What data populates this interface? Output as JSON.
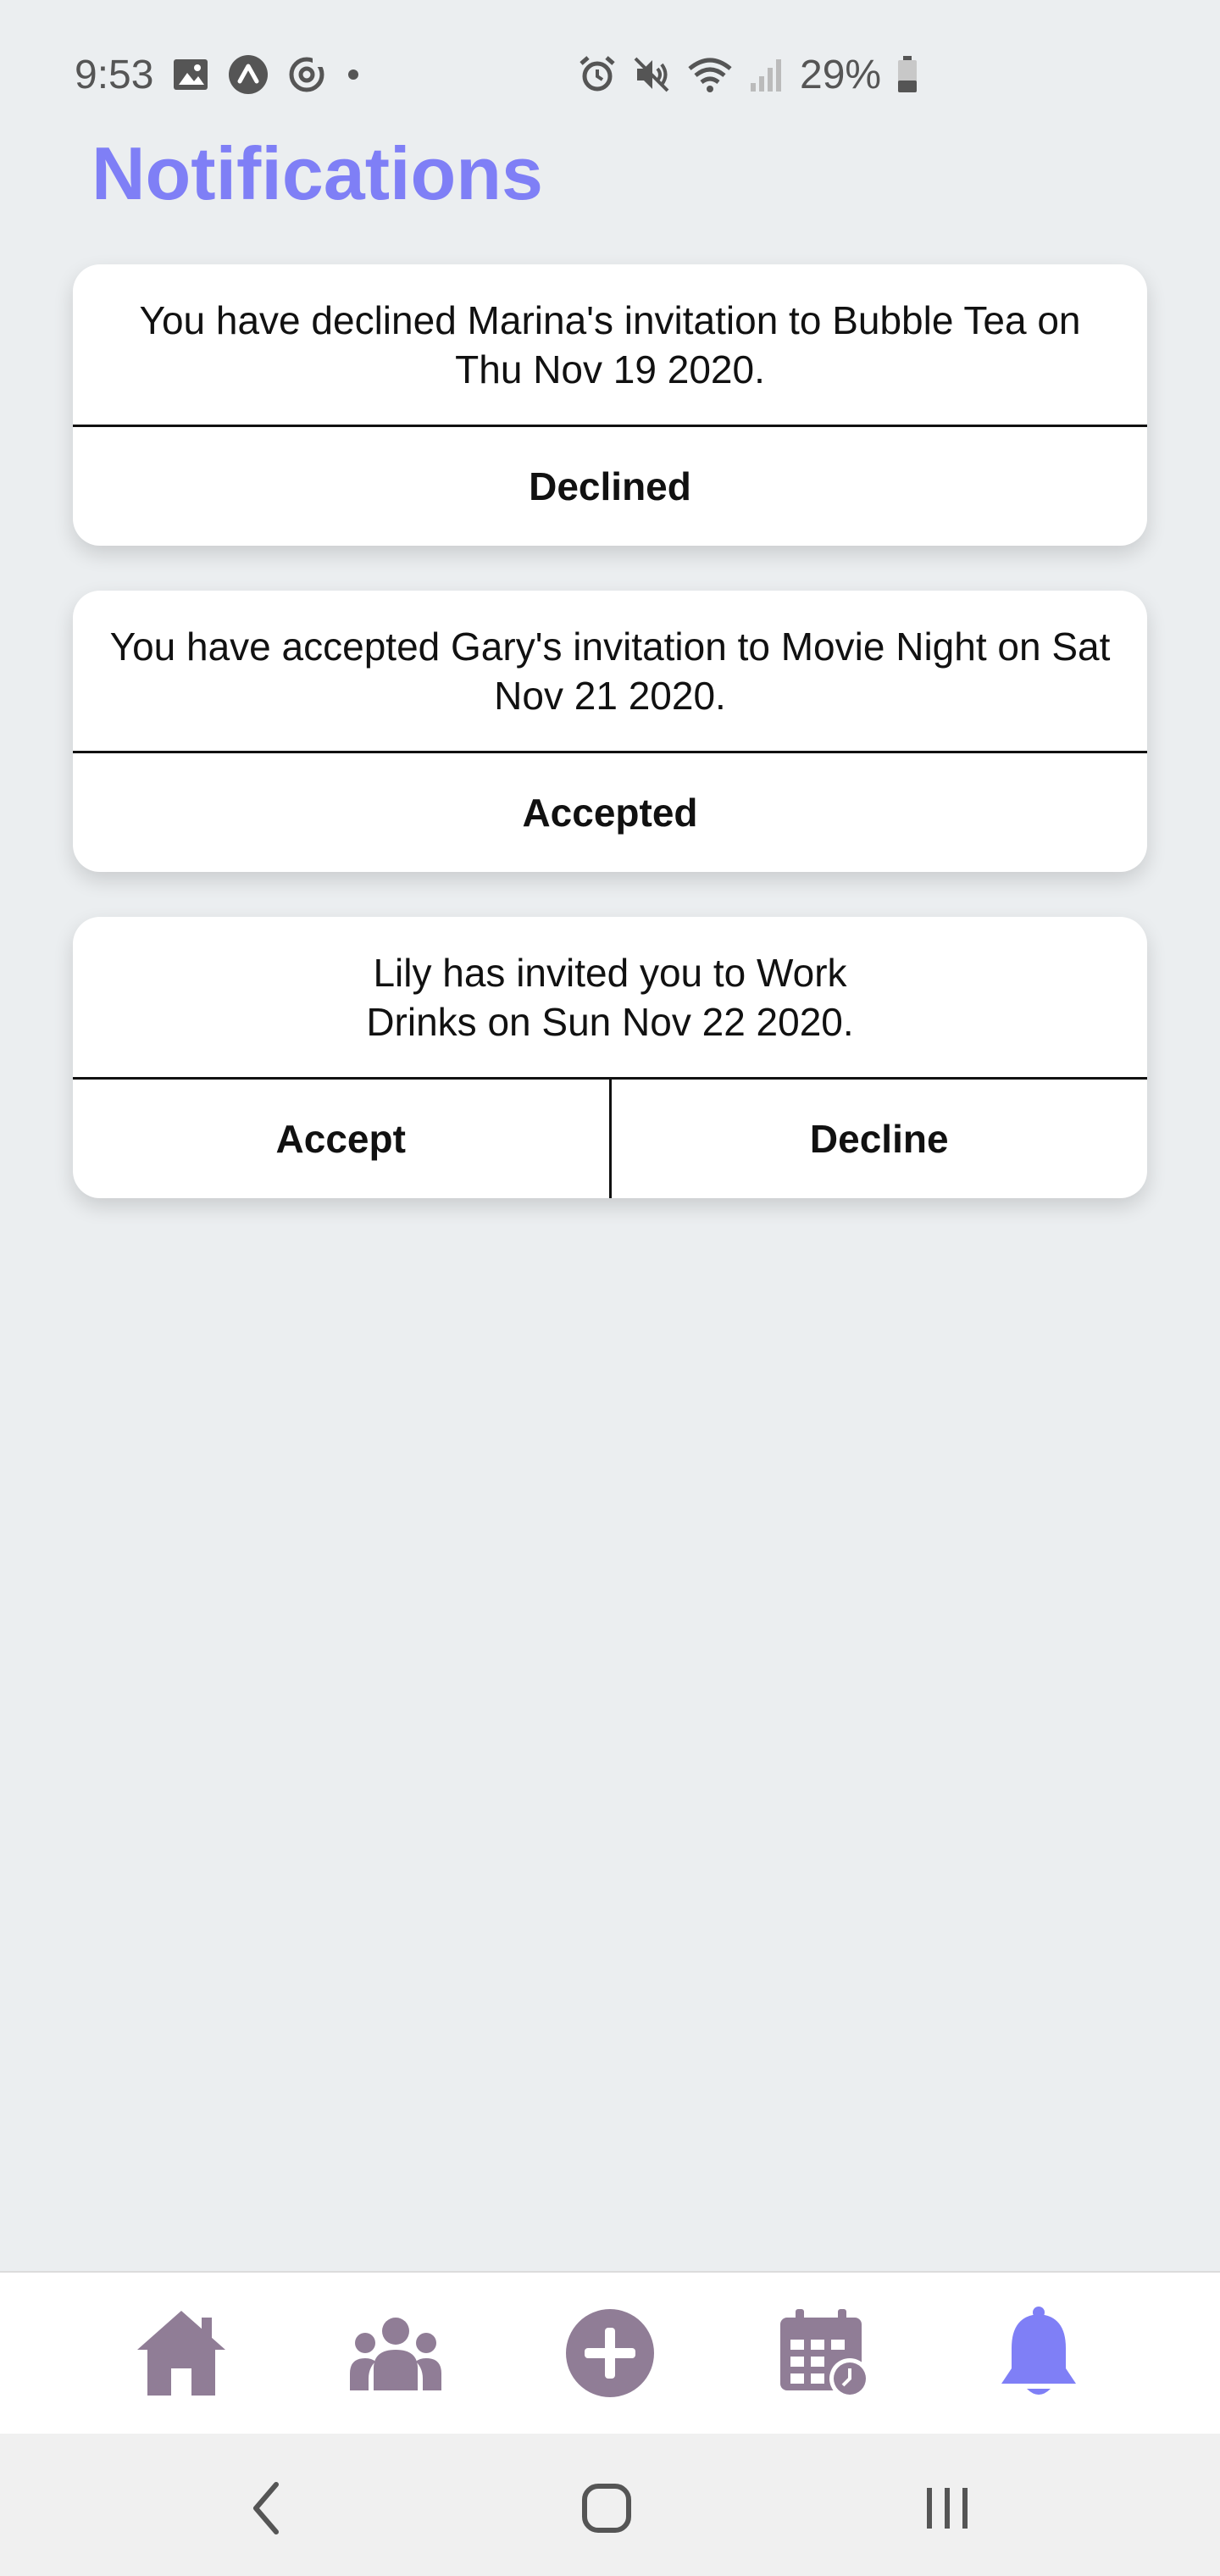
{
  "status_bar": {
    "time": "9:53",
    "battery": "29%",
    "left_icons": [
      "gallery-icon",
      "app-logo-icon",
      "sync-icon",
      "dot-icon"
    ],
    "right_icons": [
      "alarm-icon",
      "mute-icon",
      "wifi-icon",
      "signal-icon",
      "battery-icon"
    ]
  },
  "page": {
    "title": "Notifications",
    "accent_color": "#7f7ff6"
  },
  "notifications": [
    {
      "message": "You have declined Marina's invitation to Bubble Tea on Thu Nov 19 2020.",
      "actions": [
        "Declined"
      ]
    },
    {
      "message": "You have accepted Gary's invitation to Movie Night on Sat Nov 21 2020.",
      "actions": [
        "Accepted"
      ]
    },
    {
      "message": "Lily has invited you to Work Drinks on Sun Nov 22 2020.",
      "actions": [
        "Accept",
        "Decline"
      ]
    }
  ],
  "bottom_nav": {
    "items": [
      "home-icon",
      "friends-icon",
      "add-icon",
      "calendar-icon",
      "notifications-bell-icon"
    ],
    "active": "notifications-bell-icon",
    "inactive_color": "#907d96",
    "active_color": "#7f7ff6"
  },
  "system_nav": [
    "back-icon",
    "home-button-icon",
    "recents-icon"
  ]
}
